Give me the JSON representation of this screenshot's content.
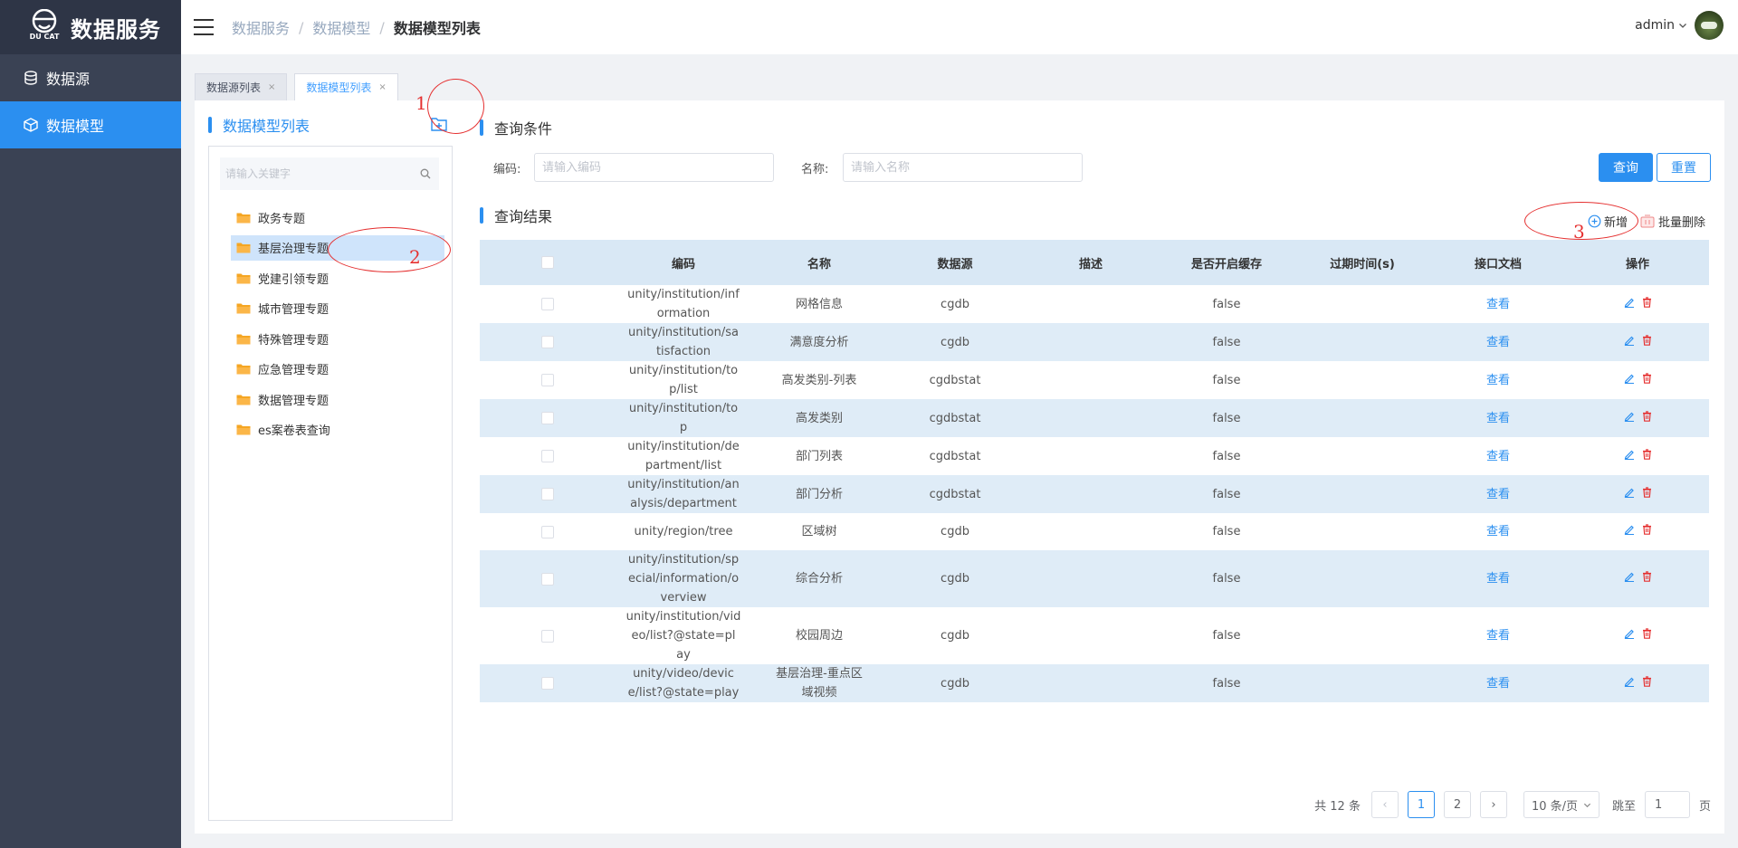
{
  "app": {
    "logo_sub": "DU CAT",
    "title": "数据服务"
  },
  "sidebar": {
    "items": [
      {
        "label": "数据源",
        "icon": "database-icon",
        "active": false
      },
      {
        "label": "数据模型",
        "icon": "cube-icon",
        "active": true
      }
    ]
  },
  "header": {
    "breadcrumb": [
      "数据服务",
      "数据模型",
      "数据模型列表"
    ],
    "user": "admin"
  },
  "tabs": [
    {
      "label": "数据源列表",
      "close": "×",
      "active": false
    },
    {
      "label": "数据模型列表",
      "close": "×",
      "active": true
    }
  ],
  "tree": {
    "title": "数据模型列表",
    "search_placeholder": "请输入关键字",
    "nodes": [
      {
        "label": "政务专题"
      },
      {
        "label": "基层治理专题",
        "active": true
      },
      {
        "label": "党建引领专题"
      },
      {
        "label": "城市管理专题"
      },
      {
        "label": "特殊管理专题"
      },
      {
        "label": "应急管理专题"
      },
      {
        "label": "数据管理专题"
      },
      {
        "label": "es案卷表查询"
      }
    ]
  },
  "query": {
    "title": "查询条件",
    "code_label": "编码:",
    "code_placeholder": "请输入编码",
    "name_label": "名称:",
    "name_placeholder": "请输入名称",
    "search_button": "查询",
    "reset_button": "重置"
  },
  "results": {
    "title": "查询结果",
    "add_label": "新增",
    "batch_delete_label": "批量删除",
    "columns": [
      "编码",
      "名称",
      "数据源",
      "描述",
      "是否开启缓存",
      "过期时间(s)",
      "接口文档",
      "操作"
    ],
    "rows": [
      {
        "code": [
          "unity/institution/inf",
          "ormation"
        ],
        "name": [
          "网格信息"
        ],
        "source": "cgdb",
        "desc": "",
        "cache": "false",
        "expire": "",
        "doc": "查看"
      },
      {
        "code": [
          "unity/institution/sa",
          "tisfaction"
        ],
        "name": [
          "满意度分析"
        ],
        "source": "cgdb",
        "desc": "",
        "cache": "false",
        "expire": "",
        "doc": "查看"
      },
      {
        "code": [
          "unity/institution/to",
          "p/list"
        ],
        "name": [
          "高发类别-列表"
        ],
        "source": "cgdbstat",
        "desc": "",
        "cache": "false",
        "expire": "",
        "doc": "查看"
      },
      {
        "code": [
          "unity/institution/to",
          "p"
        ],
        "name": [
          "高发类别"
        ],
        "source": "cgdbstat",
        "desc": "",
        "cache": "false",
        "expire": "",
        "doc": "查看"
      },
      {
        "code": [
          "unity/institution/de",
          "partment/list"
        ],
        "name": [
          "部门列表"
        ],
        "source": "cgdbstat",
        "desc": "",
        "cache": "false",
        "expire": "",
        "doc": "查看"
      },
      {
        "code": [
          "unity/institution/an",
          "alysis/department"
        ],
        "name": [
          "部门分析"
        ],
        "source": "cgdbstat",
        "desc": "",
        "cache": "false",
        "expire": "",
        "doc": "查看"
      },
      {
        "code": [
          "unity/region/tree"
        ],
        "name": [
          "区域树"
        ],
        "source": "cgdb",
        "desc": "",
        "cache": "false",
        "expire": "",
        "doc": "查看"
      },
      {
        "code": [
          "unity/institution/sp",
          "ecial/information/o",
          "verview"
        ],
        "name": [
          "综合分析"
        ],
        "source": "cgdb",
        "desc": "",
        "cache": "false",
        "expire": "",
        "doc": "查看"
      },
      {
        "code": [
          "unity/institution/vid",
          "eo/list?@state=pl",
          "ay"
        ],
        "name": [
          "校园周边"
        ],
        "source": "cgdb",
        "desc": "",
        "cache": "false",
        "expire": "",
        "doc": "查看"
      },
      {
        "code": [
          "unity/video/devic",
          "e/list?@state=play"
        ],
        "name": [
          "基层治理-重点区",
          "域视频"
        ],
        "source": "cgdb",
        "desc": "",
        "cache": "false",
        "expire": "",
        "doc": "查看"
      }
    ]
  },
  "pagination": {
    "total_text": "共 12 条",
    "pages": [
      "1",
      "2"
    ],
    "current": "1",
    "prev": "‹",
    "next": "›",
    "page_size": "10 条/页",
    "jump_label": "跳至",
    "jump_value": "1",
    "page_unit": "页"
  },
  "annotations": [
    "1",
    "2",
    "3"
  ],
  "colors": {
    "sidebar_bg": "#3a4254",
    "accent": "#2b8ff0",
    "annotation": "#e53030",
    "delete": "#e53030",
    "folder": "#f5a623"
  }
}
